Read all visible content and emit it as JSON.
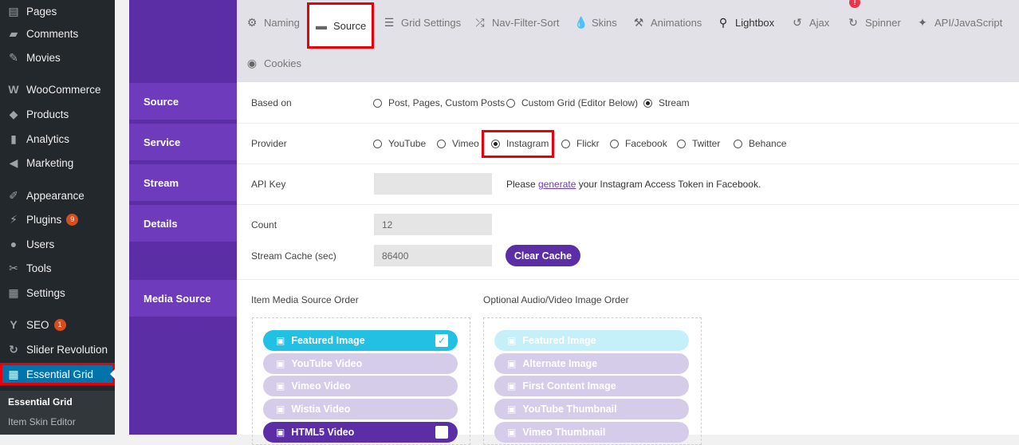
{
  "wp_menu": [
    {
      "label": "Pages",
      "icon": "pages-icon",
      "glyph": "▤",
      "badge": ""
    },
    {
      "label": "Comments",
      "icon": "comments-icon",
      "glyph": "▰",
      "badge": ""
    },
    {
      "label": "Movies",
      "icon": "pin-icon",
      "glyph": "✎",
      "badge": ""
    },
    {
      "label": "WooCommerce",
      "icon": "woocommerce-icon",
      "glyph": "W",
      "badge": ""
    },
    {
      "label": "Products",
      "icon": "products-icon",
      "glyph": "◆",
      "badge": ""
    },
    {
      "label": "Analytics",
      "icon": "analytics-icon",
      "glyph": "▮",
      "badge": ""
    },
    {
      "label": "Marketing",
      "icon": "megaphone-icon",
      "glyph": "◀",
      "badge": ""
    },
    {
      "label": "Appearance",
      "icon": "brush-icon",
      "glyph": "✐",
      "badge": ""
    },
    {
      "label": "Plugins",
      "icon": "plugin-icon",
      "glyph": "⚡",
      "badge": "9"
    },
    {
      "label": "Users",
      "icon": "users-icon",
      "glyph": "●",
      "badge": ""
    },
    {
      "label": "Tools",
      "icon": "wrench-icon",
      "glyph": "✂",
      "badge": ""
    },
    {
      "label": "Settings",
      "icon": "settings-icon",
      "glyph": "▦",
      "badge": ""
    },
    {
      "label": "SEO",
      "icon": "yoast-icon",
      "glyph": "Y",
      "badge": "1"
    },
    {
      "label": "Slider Revolution",
      "icon": "refresh-icon",
      "glyph": "↻",
      "badge": ""
    },
    {
      "label": "Essential Grid",
      "icon": "grid-icon",
      "glyph": "▦",
      "badge": ""
    }
  ],
  "wp_submenu": [
    "Essential Grid",
    "Item Skin Editor"
  ],
  "tabs": [
    {
      "label": "Naming",
      "icon": "gear-icon",
      "glyph": "⚙"
    },
    {
      "label": "Source",
      "icon": "folder-icon",
      "glyph": "▬"
    },
    {
      "label": "Grid Settings",
      "icon": "menu-icon",
      "glyph": "☰"
    },
    {
      "label": "Nav-Filter-Sort",
      "icon": "shuffle-icon",
      "glyph": "⤮"
    },
    {
      "label": "Skins",
      "icon": "drop-icon",
      "glyph": "💧"
    },
    {
      "label": "Animations",
      "icon": "tools-icon",
      "glyph": "⚒"
    },
    {
      "label": "Lightbox",
      "icon": "search-icon",
      "glyph": "⚲"
    },
    {
      "label": "Ajax",
      "icon": "undo-icon",
      "glyph": "↺"
    },
    {
      "label": "Spinner",
      "icon": "history-icon",
      "glyph": "↻"
    },
    {
      "label": "API/JavaScript",
      "icon": "magic-wand-icon",
      "glyph": "✦"
    },
    {
      "label": "Cookies",
      "icon": "eye-icon",
      "glyph": "◉"
    }
  ],
  "notification": "!",
  "sections": [
    "Source",
    "Service",
    "Stream",
    "Details",
    "Media Source"
  ],
  "based_on": {
    "label": "Based on",
    "options": [
      "Post, Pages, Custom Posts",
      "Custom Grid (Editor Below)",
      "Stream"
    ],
    "selected": "Stream"
  },
  "provider": {
    "label": "Provider",
    "options": [
      "YouTube",
      "Vimeo",
      "Instagram",
      "Flickr",
      "Facebook",
      "Twitter",
      "Behance"
    ],
    "selected": "Instagram"
  },
  "api_key": {
    "label": "API Key",
    "value": "",
    "help_prefix": "Please ",
    "help_link": "generate",
    "help_suffix": " your Instagram Access Token in Facebook."
  },
  "count": {
    "label": "Count",
    "value": "12"
  },
  "stream_cache": {
    "label": "Stream Cache (sec)",
    "value": "86400"
  },
  "clear_cache_label": "Clear Cache",
  "media_order": {
    "title": "Item Media Source Order",
    "items": [
      {
        "label": "Featured Image",
        "style": "featured",
        "check": "✓"
      },
      {
        "label": "YouTube Video",
        "style": "",
        "check": ""
      },
      {
        "label": "Vimeo Video",
        "style": "",
        "check": ""
      },
      {
        "label": "Wistia Video",
        "style": "",
        "check": ""
      },
      {
        "label": "HTML5 Video",
        "style": "html5",
        "check": ""
      }
    ]
  },
  "av_order": {
    "title": "Optional Audio/Video Image Order",
    "items": [
      {
        "label": "Featured Image",
        "style": "featured-pale"
      },
      {
        "label": "Alternate Image",
        "style": ""
      },
      {
        "label": "First Content Image",
        "style": ""
      },
      {
        "label": "YouTube Thumbnail",
        "style": ""
      },
      {
        "label": "Vimeo Thumbnail",
        "style": ""
      }
    ]
  }
}
